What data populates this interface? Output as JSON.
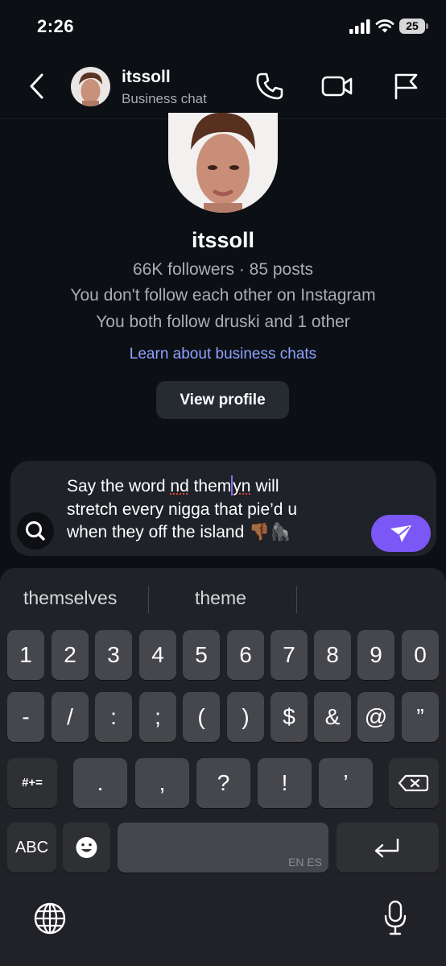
{
  "status": {
    "time": "2:26",
    "battery": "25"
  },
  "header": {
    "name": "itssoll",
    "subtitle": "Business chat"
  },
  "profile": {
    "name": "itssoll",
    "stats": "66K followers · 85 posts",
    "follow_status": "You don't follow each other on Instagram",
    "mutual": "You both follow druski and 1 other",
    "learn_link": "Learn about business chats",
    "view_button": "View profile"
  },
  "composer": {
    "line1_a": "Say the word ",
    "line1_b": "nd",
    "line1_c": " them",
    "line1_d": "yn",
    "line1_e": " will",
    "line2": "stretch every nigga that pie’d u",
    "line3": "when they off the island 👎🏾🦍"
  },
  "keyboard": {
    "suggestions": [
      "themselves",
      "theme"
    ],
    "number_row": [
      "1",
      "2",
      "3",
      "4",
      "5",
      "6",
      "7",
      "8",
      "9",
      "0"
    ],
    "symbol_row": [
      "-",
      "/",
      ":",
      ";",
      "(",
      ")",
      "$",
      "&",
      "@",
      "”"
    ],
    "punct_row": [
      ".",
      ",",
      "?",
      "!",
      "’"
    ],
    "symbols_toggle": "#+=",
    "abc_key": "ABC",
    "space_languages": "EN ES"
  }
}
